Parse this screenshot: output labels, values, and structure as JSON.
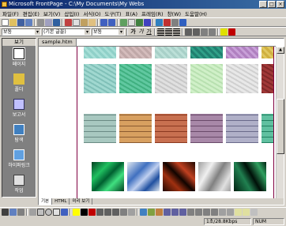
{
  "window": {
    "title": "Microsoft FrontPage - C:\\My Documents\\My Webs",
    "minimize": "_",
    "maximize": "□",
    "close": "×"
  },
  "menu": [
    "파일(F)",
    "편집(E)",
    "보기(V)",
    "삽입(I)",
    "서식(O)",
    "도구(T)",
    "표(A)",
    "프레임(R)",
    "창(W)",
    "도움말(H)"
  ],
  "format_toolbar": {
    "style": "보통",
    "font": "(기본 글꼴)",
    "size": "보통"
  },
  "views": {
    "header": "보기",
    "items": [
      {
        "label": "페이지",
        "icon": "page-view-icon",
        "selected": true
      },
      {
        "label": "폴더",
        "icon": "folder-view-icon",
        "selected": false
      },
      {
        "label": "보고서",
        "icon": "reports-view-icon",
        "selected": false
      },
      {
        "label": "탐색",
        "icon": "navigation-view-icon",
        "selected": false
      },
      {
        "label": "하이퍼링크",
        "icon": "hyperlinks-view-icon",
        "selected": false
      },
      {
        "label": "작업",
        "icon": "tasks-view-icon",
        "selected": false
      }
    ]
  },
  "document": {
    "tab": "sample.htm",
    "view_tabs": [
      "기본",
      "HTML",
      "미리 보기"
    ]
  },
  "status": {
    "download_time": "1초/28.8Kbps",
    "num": "NUM"
  },
  "colors": {
    "title_bar": "#0a246a",
    "views_bar_bg": "#808080",
    "page_border": "#800040",
    "chrome": "#d4d0c8"
  }
}
